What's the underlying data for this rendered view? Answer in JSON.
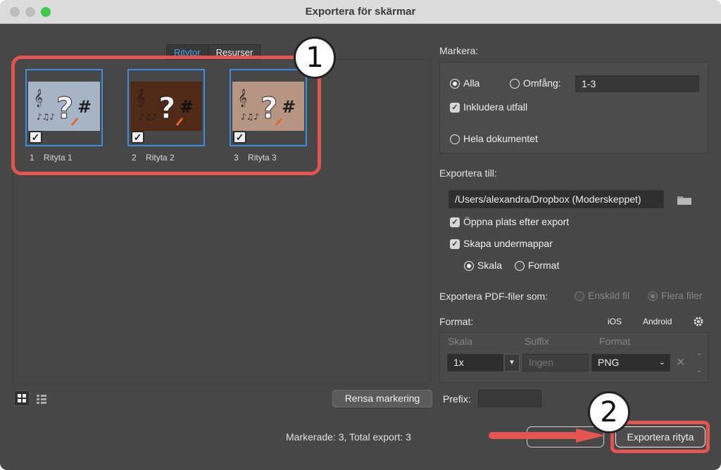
{
  "window": {
    "title": "Exportera för skärmar",
    "traffic_lights": {
      "close": "#ee5f57",
      "minimize": "#f7be38",
      "zoom": "#3fc84c"
    }
  },
  "tabs": [
    {
      "label": "Ritytor",
      "active": true
    },
    {
      "label": "Resurser",
      "active": false
    }
  ],
  "artboards": [
    {
      "number": "1",
      "name": "Rityta 1",
      "bg": "#a6b4c6",
      "checked": true
    },
    {
      "number": "2",
      "name": "Rityta 2",
      "bg": "#4f2a16",
      "checked": true
    },
    {
      "number": "3",
      "name": "Rityta 3",
      "bg": "#b69582",
      "checked": true
    }
  ],
  "annotations": {
    "badge1": "1",
    "badge2": "2",
    "color": "#e45552"
  },
  "select": {
    "label": "Markera:",
    "all": "Alla",
    "range": "Omfång:",
    "range_value": "1-3",
    "include_bleed": "Inkludera utfall",
    "whole_document": "Hela dokumentet"
  },
  "export_to": {
    "label": "Exportera till:",
    "path": "/Users/alexandra/Dropbox (Moderskeppet)",
    "open_location": "Öppna plats efter export",
    "create_subfolders": "Skapa undermappar",
    "scale": "Skala",
    "format": "Format"
  },
  "pdf": {
    "label": "Exportera PDF-filer som:",
    "single": "Enskild fil",
    "multiple": "Flera filer"
  },
  "format": {
    "label": "Format:",
    "ios": "iOS",
    "android": "Android",
    "col_scale": "Skala",
    "col_suffix": "Suffix",
    "col_format": "Format",
    "row_scale": "1x",
    "row_suffix_placeholder": "Ingen",
    "row_format": "PNG"
  },
  "bottom": {
    "clear_selection": "Rensa markering",
    "prefix_label": "Prefix:",
    "status": "Markerade: 3, Total export: 3",
    "export_button": "Exportera rityta"
  }
}
